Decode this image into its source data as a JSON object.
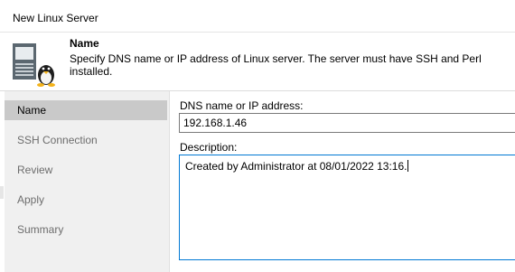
{
  "window": {
    "title": "New Linux Server"
  },
  "header": {
    "title": "Name",
    "description": "Specify DNS name or IP address of Linux server. The server must have SSH and Perl installed.",
    "icon": "linux-server-icon"
  },
  "sidebar": {
    "items": [
      {
        "label": "Name",
        "active": true
      },
      {
        "label": "SSH Connection",
        "active": false
      },
      {
        "label": "Review",
        "active": false
      },
      {
        "label": "Apply",
        "active": false
      },
      {
        "label": "Summary",
        "active": false
      }
    ]
  },
  "form": {
    "dns_label": "DNS name or IP address:",
    "dns_value": "192.168.1.46",
    "description_label": "Description:",
    "description_value": "Created by Administrator at 08/01/2022 13:16."
  },
  "colors": {
    "accent": "#0078d4",
    "active_nav": "#c9c9c9",
    "sidebar_bg": "#f0f0f0"
  }
}
